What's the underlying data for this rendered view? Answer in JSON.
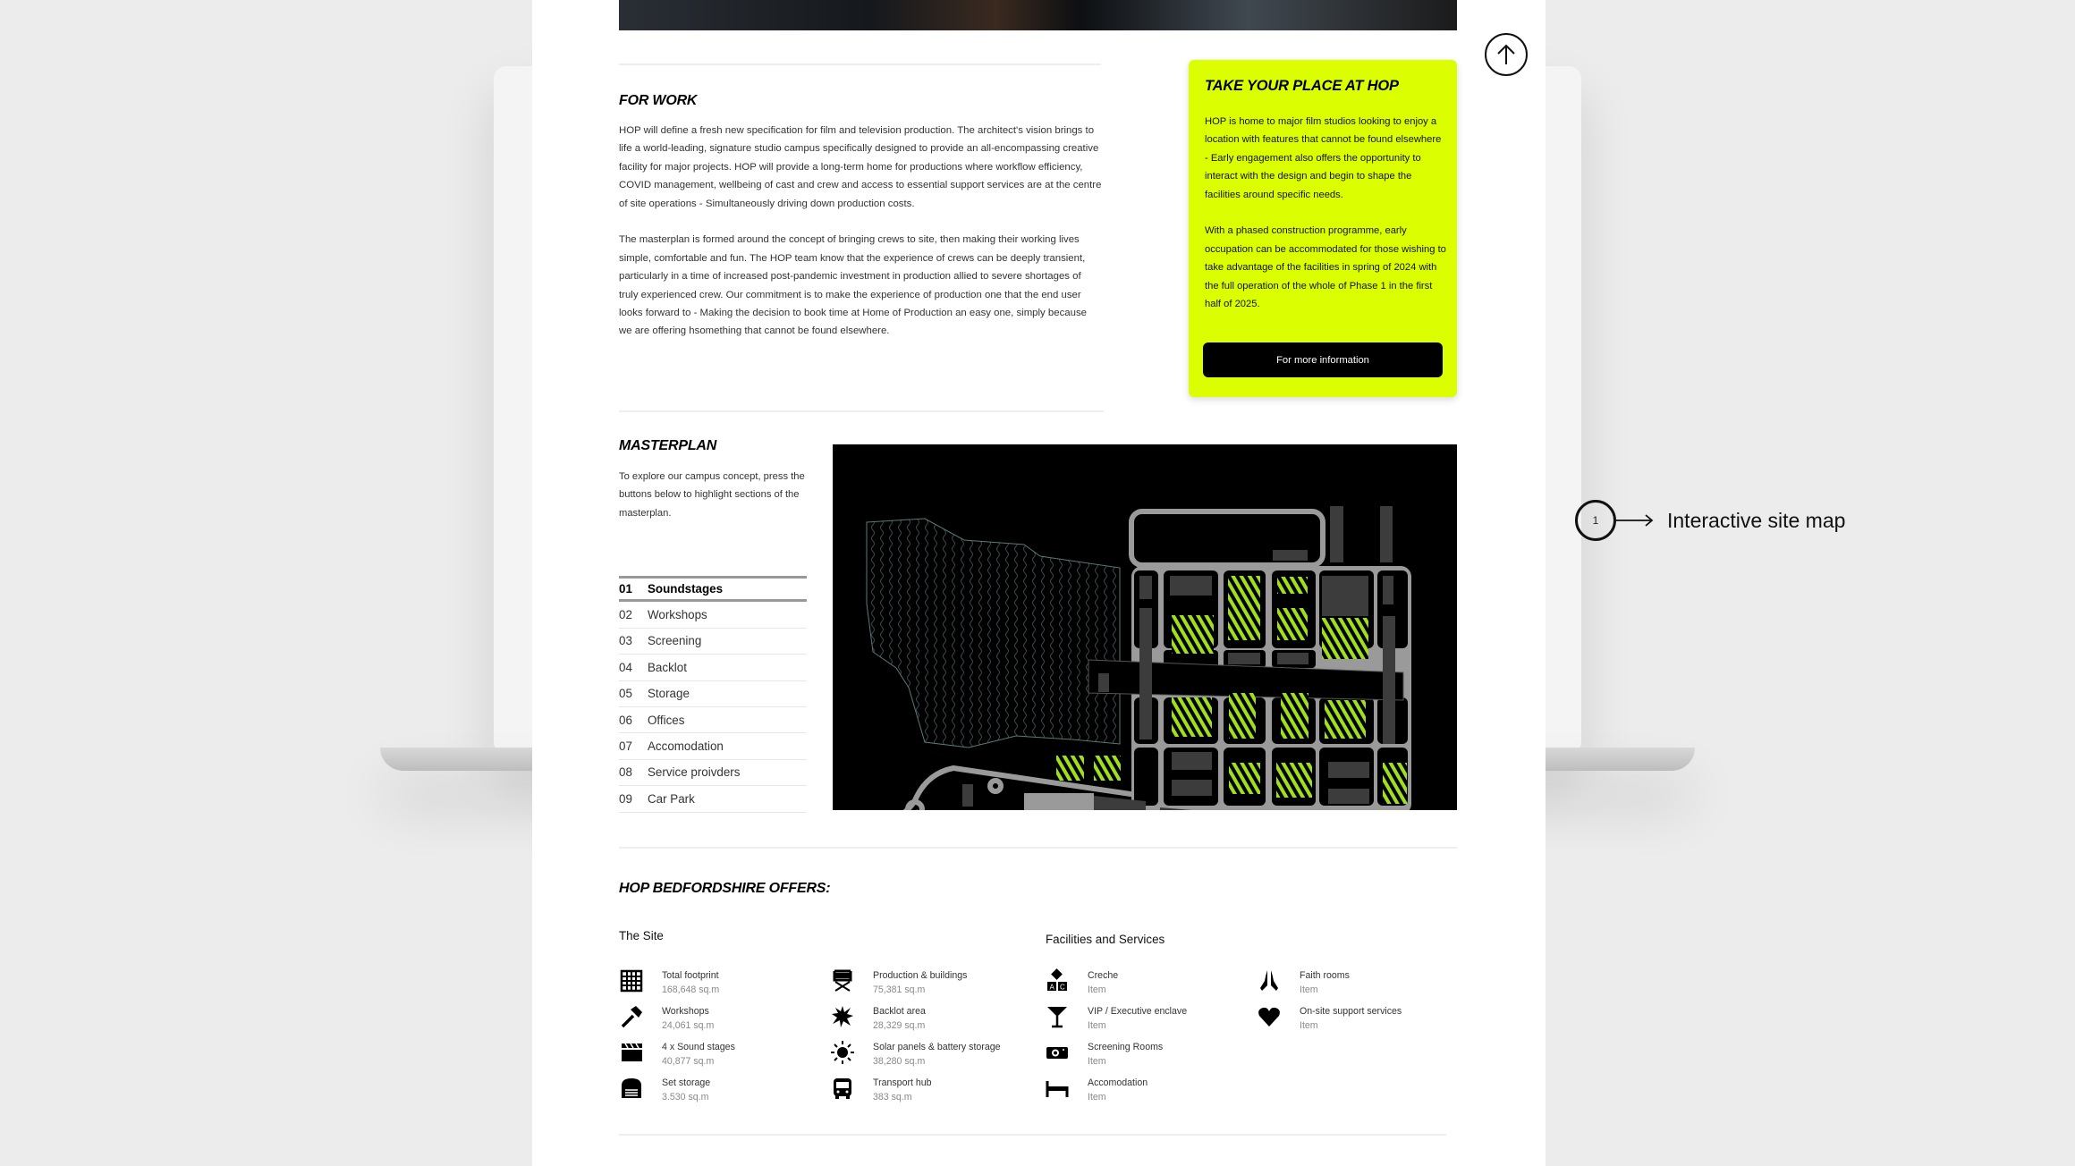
{
  "for_work": {
    "title": "FOR WORK",
    "paragraphs": [
      "HOP will define a fresh new specification for film and television production. The architect's vision brings to life a world-leading, signature studio campus specifically designed to provide an all-encompassing creative facility for major projects. HOP will provide a long-term home for productions where workflow efficiency,  COVID management, wellbeing of cast and crew and access to essential support services are at the centre of site operations - Simultaneously driving down production costs.",
      "The masterplan is formed around the concept of bringing crews to site, then making their working lives simple, comfortable and fun. The HOP team know that the experience of crews can be deeply transient, particularly in a time of increased post-pandemic investment in production allied to severe shortages of truly experienced crew. Our commitment is to make the experience of production one that the end user looks forward to - Making the decision to book time at Home of Production an easy one, simply because we are offering hsomething that cannot be found elsewhere."
    ]
  },
  "card": {
    "title": "TAKE YOUR PLACE AT HOP",
    "paragraphs": [
      "HOP is home to major film studios looking to enjoy a location with features that cannot be found elsewhere - Early engagement also offers the opportunity to interact with the design and begin to shape the facilities around specific needs.",
      "With a phased construction programme, early occupation can be accommodated for those wishing to take advantage of the facilities in spring of 2024 with the full operation of the whole of Phase 1 in the first half of 2025."
    ],
    "button": "For more information",
    "color": "#dcff00"
  },
  "masterplan": {
    "title": "MASTERPLAN",
    "intro": "To explore our campus concept, press the buttons below to highlight sections of the masterplan.",
    "items": [
      {
        "n": "01",
        "label": "Soundstages",
        "active": true
      },
      {
        "n": "02",
        "label": "Workshops"
      },
      {
        "n": "03",
        "label": "Screening"
      },
      {
        "n": "04",
        "label": "Backlot"
      },
      {
        "n": "05",
        "label": "Storage"
      },
      {
        "n": "06",
        "label": "Offices"
      },
      {
        "n": "07",
        "label": "Accomodation"
      },
      {
        "n": "08",
        "label": "Service proivders"
      },
      {
        "n": "09",
        "label": "Car Park"
      }
    ],
    "highlight_color": "#9ee01a"
  },
  "offers": {
    "title": "HOP BEDFORDSHIRE OFFERS:",
    "site_title": "The Site",
    "facilities_title": "Facilities and Services",
    "site": [
      {
        "icon": "grid-icon",
        "label": "Total footprint",
        "value": "168,648 sq.m"
      },
      {
        "icon": "hammer-icon",
        "label": "Workshops",
        "value": "24,061 sq.m"
      },
      {
        "icon": "clapperboard-icon",
        "label": "4 x Sound stages",
        "value": "40,877 sq.m"
      },
      {
        "icon": "garage-icon",
        "label": "Set storage",
        "value": "3.530 sq.m"
      },
      {
        "icon": "director-chair-icon",
        "label": "Production & buildings",
        "value": "75,381 sq.m"
      },
      {
        "icon": "explosion-icon",
        "label": "Backlot area",
        "value": "28,329 sq.m"
      },
      {
        "icon": "sun-icon",
        "label": "Solar panels & battery storage",
        "value": "38,280 sq.m"
      },
      {
        "icon": "bus-icon",
        "label": "Transport hub",
        "value": "383 sq.m"
      }
    ],
    "facilities": [
      {
        "icon": "abc-blocks-icon",
        "label": "Creche",
        "value": "Item"
      },
      {
        "icon": "cocktail-icon",
        "label": "VIP / Executive enclave",
        "value": "Item"
      },
      {
        "icon": "projector-icon",
        "label": "Screening Rooms",
        "value": "Item"
      },
      {
        "icon": "bed-icon",
        "label": "Accomodation",
        "value": "Item"
      },
      {
        "icon": "praying-hands-icon",
        "label": "Faith rooms",
        "value": "Item"
      },
      {
        "icon": "heart-icon",
        "label": "On-site support services",
        "value": "Item"
      }
    ]
  },
  "annotation": {
    "number": "1",
    "label": "Interactive site map"
  }
}
